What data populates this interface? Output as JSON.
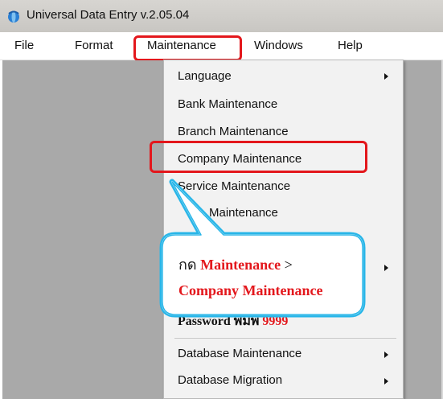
{
  "window": {
    "title": "Universal Data Entry v.2.05.04",
    "icon": "app-logo-icon"
  },
  "menubar": {
    "items": [
      "File",
      "Format",
      "Maintenance",
      "Windows",
      "Help"
    ],
    "highlighted": "Maintenance"
  },
  "dropdown": {
    "items": [
      {
        "label": "Language",
        "submenu": true
      },
      {
        "label": "Bank Maintenance",
        "submenu": false
      },
      {
        "label": "Branch Maintenance",
        "submenu": false
      },
      {
        "label": "Company Maintenance",
        "submenu": false,
        "highlighted": true
      },
      {
        "label": "Service Maintenance",
        "submenu": false
      },
      {
        "label": "Maintenance",
        "submenu": false,
        "obscured": true
      }
    ],
    "password_line": {
      "text": "Password พิมพ์ ",
      "code": "9999"
    },
    "bottom_items": [
      {
        "label": "Database Maintenance",
        "submenu": true
      },
      {
        "label": "Database Migration",
        "submenu": true
      }
    ]
  },
  "callout": {
    "line1_prefix": "กด",
    "line1_highlight": "Maintenance",
    "line1_suffix": ">",
    "line2": "Company Maintenance",
    "border_color": "#29b6e8"
  },
  "colors": {
    "highlight_red": "#e3171c",
    "client_bg": "#a9a9a9"
  }
}
